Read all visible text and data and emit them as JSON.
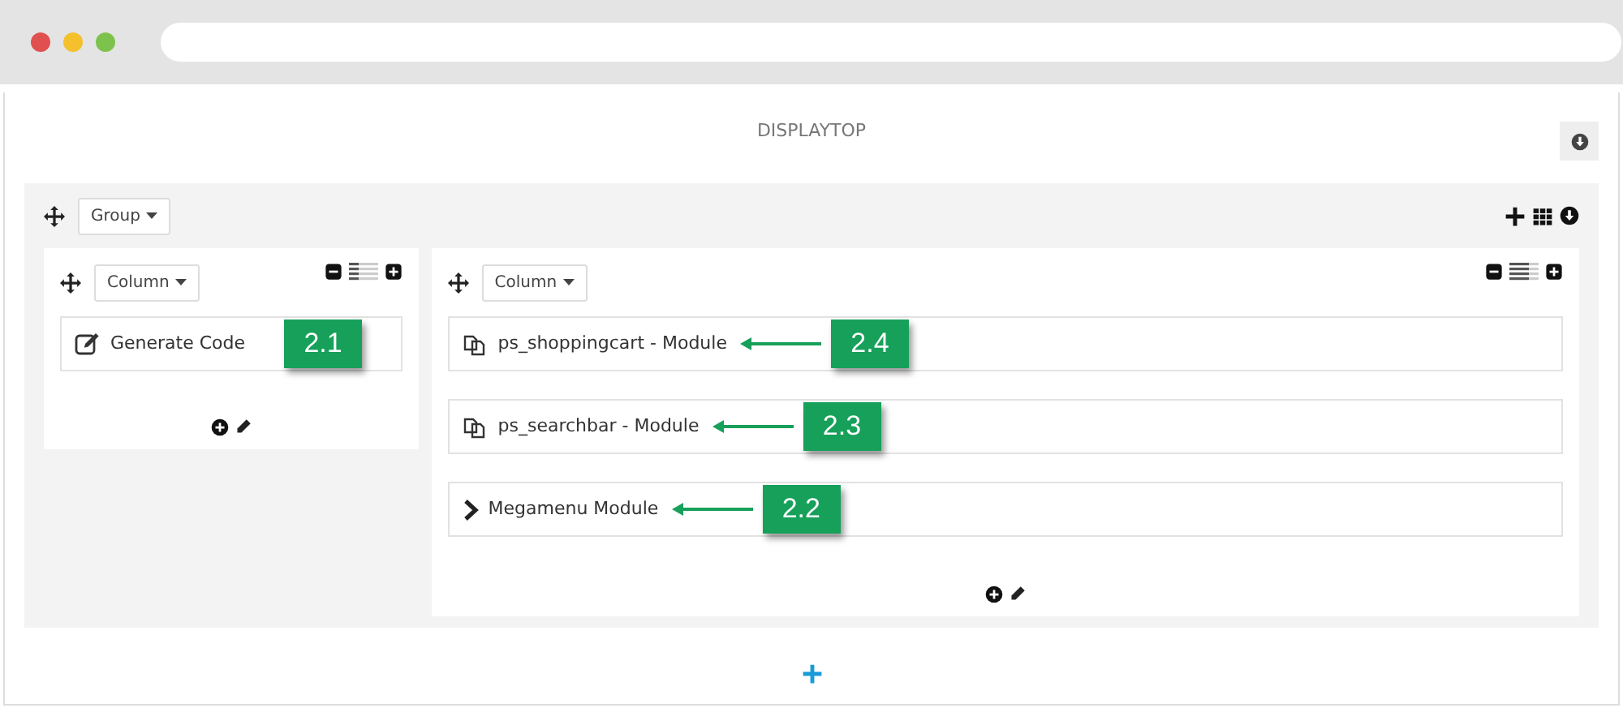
{
  "title": "DISPLAYTOP",
  "group": {
    "label": "Group"
  },
  "columns": [
    {
      "label": "Column",
      "modules": [
        {
          "kind": "edit",
          "name": "Generate Code",
          "callout": "2.1",
          "arrow": false
        }
      ]
    },
    {
      "label": "Column",
      "modules": [
        {
          "kind": "module",
          "name": "ps_shoppingcart - Module",
          "callout": "2.4",
          "arrow": true
        },
        {
          "kind": "module",
          "name": "ps_searchbar - Module",
          "callout": "2.3",
          "arrow": true
        },
        {
          "kind": "menu",
          "name": "Megamenu Module",
          "callout": "2.2",
          "arrow": true
        }
      ]
    }
  ]
}
